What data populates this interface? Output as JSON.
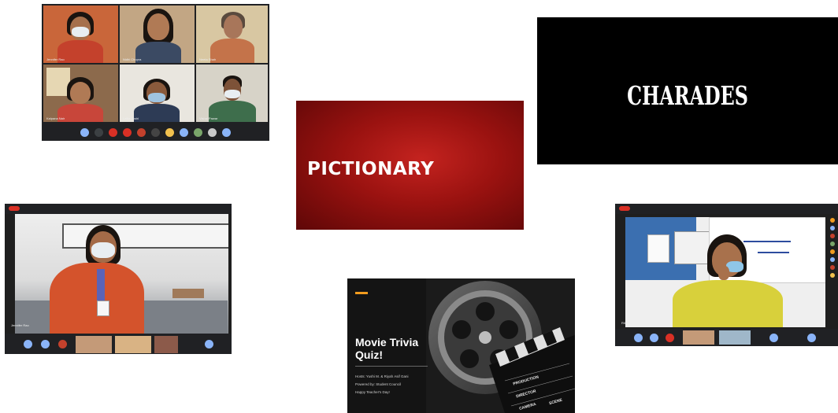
{
  "tiles": {
    "video_grid": {
      "participants": [
        {
          "name": "Jennifer Rao"
        },
        {
          "name": "Nidhi Chopra"
        },
        {
          "name": "Neeta Shah"
        },
        {
          "name": "Kalpana Nair"
        },
        {
          "name": "Lalita Joshi"
        },
        {
          "name": "Vishal Pawar"
        }
      ]
    },
    "pictionary": {
      "title": "PICTIONARY"
    },
    "charades": {
      "title": "CHARADES"
    },
    "movie_trivia": {
      "title_line1": "Movie Trivia",
      "title_line2": "Quiz!",
      "host_line": "Hosts: Yushi M. & Riyah Asif Gani",
      "powered_line": "Powered by: Student Council",
      "greeting_line": "Happy Teacher's Day!",
      "clapper_production": "PRODUCTION",
      "clapper_director": "DIRECTOR",
      "clapper_camera": "CAMERA",
      "clapper_scene": "SCENE"
    },
    "teacher_office": {
      "caption": "Jennifer Rao"
    },
    "teacher_whiteboard": {
      "caption": "Ritu Raj"
    }
  },
  "colors": {
    "pictionary_red": "#9a1210",
    "movie_accent": "#f29c1f",
    "meet_red": "#d93025"
  }
}
